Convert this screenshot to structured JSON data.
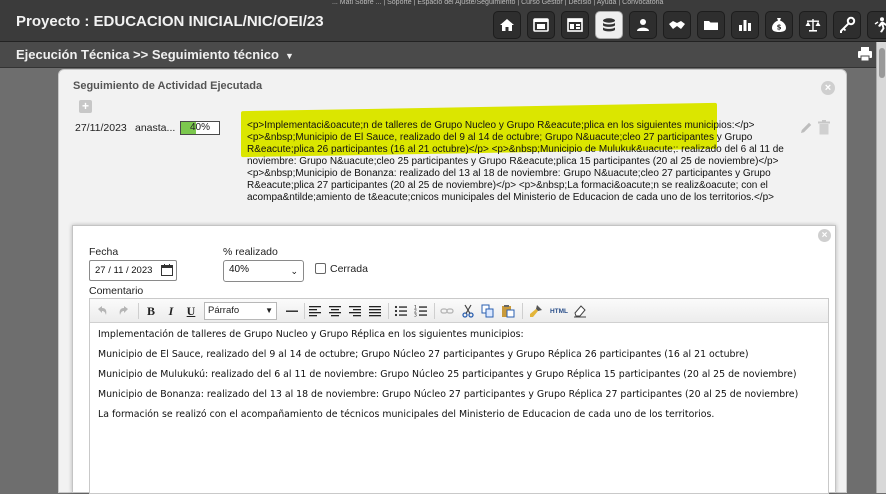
{
  "top_link_strip": "... Mati Sobre ... | Soporte | Espacio del Ajuste/Seguimiento | Curso Gestor | Decisio | Ayuda | Convocatoria",
  "project_title": "Proyecto : EDUCACION INICIAL/NIC/OEI/23",
  "toolbar_icons": [
    "home-icon",
    "window-icon",
    "dashboard-icon",
    "database-icon",
    "users-icon",
    "handshake-icon",
    "folder-icon",
    "chart-icon",
    "money-icon",
    "scale-icon",
    "key-icon",
    "exit-icon"
  ],
  "breadcrumb": "Ejecución Técnica >> Seguimiento técnico",
  "panel": {
    "title": "Seguimiento de Actividad Ejecutada",
    "entry": {
      "date": "27/11/2023",
      "user": "anasta...",
      "progress_label": "40%",
      "progress_value": 0.4,
      "description": "<p>Implementaci&oacute;n de talleres de Grupo Nucleo y Grupo R&eacute;plica en los siguientes municipios:</p> <p>&nbsp;Municipio de El Sauce, realizado del 9 al 14 de octubre; Grupo N&uacute;cleo 27 participantes y Grupo R&eacute;plica 26 participantes (16 al 21 octubre)</p> <p>&nbsp;Municipio de Mulukuk&uacute;: realizado del 6 al 11 de noviembre: Grupo N&uacute;cleo 25 participantes y Grupo R&eacute;plica 15 participantes (20 al 25 de noviembre)</p> <p>&nbsp;Municipio de Bonanza: realizado del 13 al 18 de noviembre: Grupo N&uacute;cleo 27 participantes y Grupo R&eacute;plica 27 participantes (20 al 25 de noviembre)</p> <p>&nbsp;La formaci&oacute;n se realiz&oacute; con el acompa&ntilde;amiento de t&eacute;cnicos municipales del Ministerio de Educacion de cada uno de los territorios.</p>"
    }
  },
  "dialog": {
    "fecha_label": "Fecha",
    "fecha_value": "27 / 11 / 2023",
    "pct_label": "% realizado",
    "pct_value": "40%",
    "cerrada_label": "Cerrada",
    "comentario_label": "Comentario",
    "format_value": "Párrafo",
    "paragraphs": [
      "Implementación de talleres de Grupo Nucleo y Grupo Réplica en los siguientes municipios:",
      " Municipio de El Sauce, realizado del 9 al 14 de octubre; Grupo Núcleo 27 participantes y Grupo Réplica 26 participantes (16 al 21 octubre)",
      " Municipio de Mulukukú: realizado del 6 al 11 de noviembre: Grupo Núcleo 25 participantes y Grupo Réplica 15 participantes (20 al 25 de noviembre)",
      " Municipio de Bonanza: realizado del 13 al 18 de noviembre: Grupo Núcleo 27 participantes y Grupo Réplica 27 participantes (20 al 25 de noviembre)",
      " La formación se realizó con el acompañamiento de técnicos municipales del Ministerio de Educacion de cada uno de los territorios."
    ]
  },
  "colors": {
    "topbar": "#3b3b3b",
    "progress_fill": "#7cc84e",
    "highlight": "#dbe600"
  }
}
